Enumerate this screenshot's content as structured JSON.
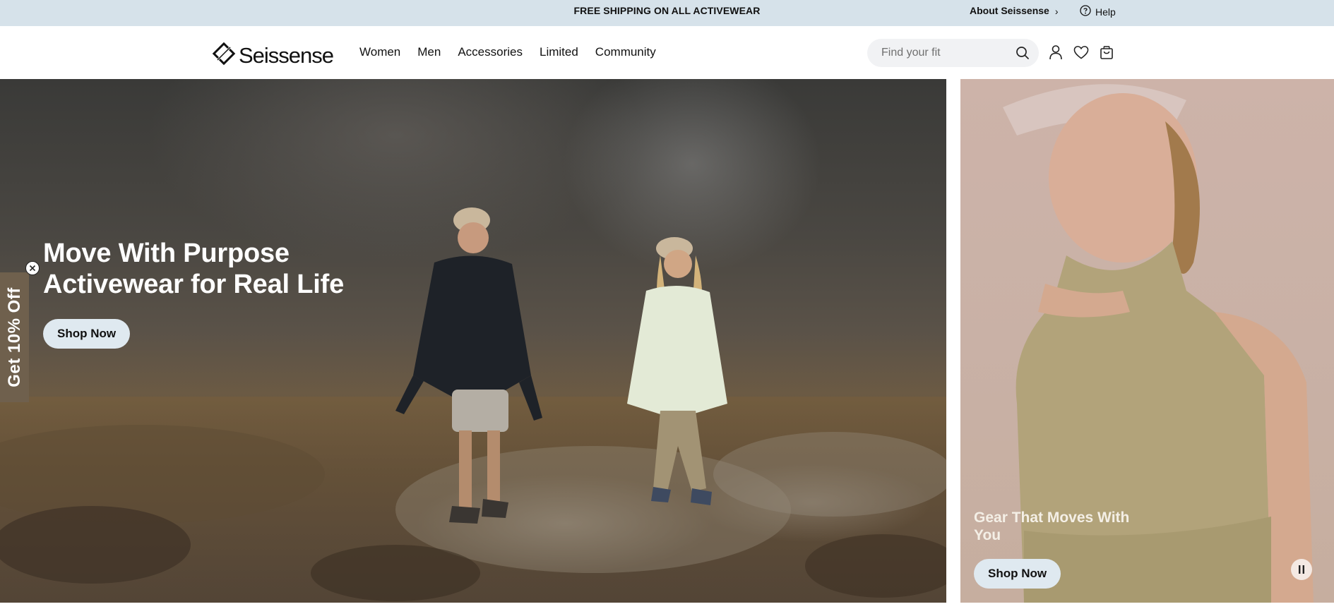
{
  "topbar": {
    "promo": "FREE SHIPPING ON ALL ACTIVEWEAR",
    "about_label": "About Seissense",
    "about_chevron": "›",
    "help_label": "Help"
  },
  "header": {
    "brand": "Seissense",
    "nav": [
      "Women",
      "Men",
      "Accessories",
      "Limited",
      "Community"
    ],
    "search_placeholder": "Find your fit",
    "icons": [
      "account-icon",
      "heart-icon",
      "bag-icon"
    ]
  },
  "hero_main": {
    "headline_line1": "Move With Purpose",
    "headline_line2": "Activewear for Real Life",
    "cta": "Shop Now"
  },
  "hero_side": {
    "caption": "Gear That Moves With You",
    "cta": "Shop Now"
  },
  "side_promo": {
    "label": "Get 10% Off"
  },
  "colors": {
    "topbar_bg": "#d6e2ea",
    "button_bg": "#dfe9f0",
    "promo_tab_bg": "#6f604d"
  }
}
